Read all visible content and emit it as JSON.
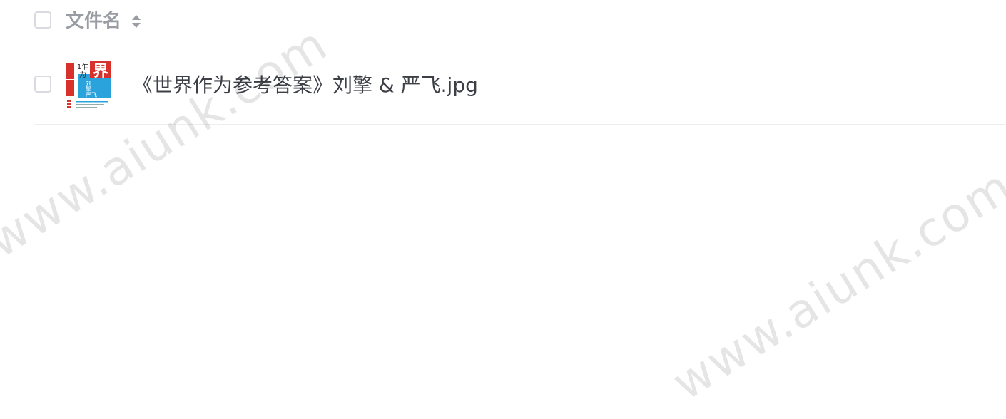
{
  "header": {
    "column_label": "文件名",
    "sort_icon": "sort-icon"
  },
  "files": [
    {
      "name": "《世界作为参考答案》刘擎 & 严飞.jpg",
      "thumbnail": {
        "cover_main": "界",
        "cover_small": "作为",
        "cover_authors": "刘擎 严飞"
      }
    }
  ],
  "watermarks": [
    "www.aiunk.com",
    "www.aiunk.com"
  ],
  "colors": {
    "header_text": "#9a9ca3",
    "file_text": "#3c3f46",
    "checkbox_border": "#d9dbe0",
    "divider": "#eceef2",
    "thumb_red": "#d8312b",
    "thumb_blue": "#2aa3dc"
  }
}
